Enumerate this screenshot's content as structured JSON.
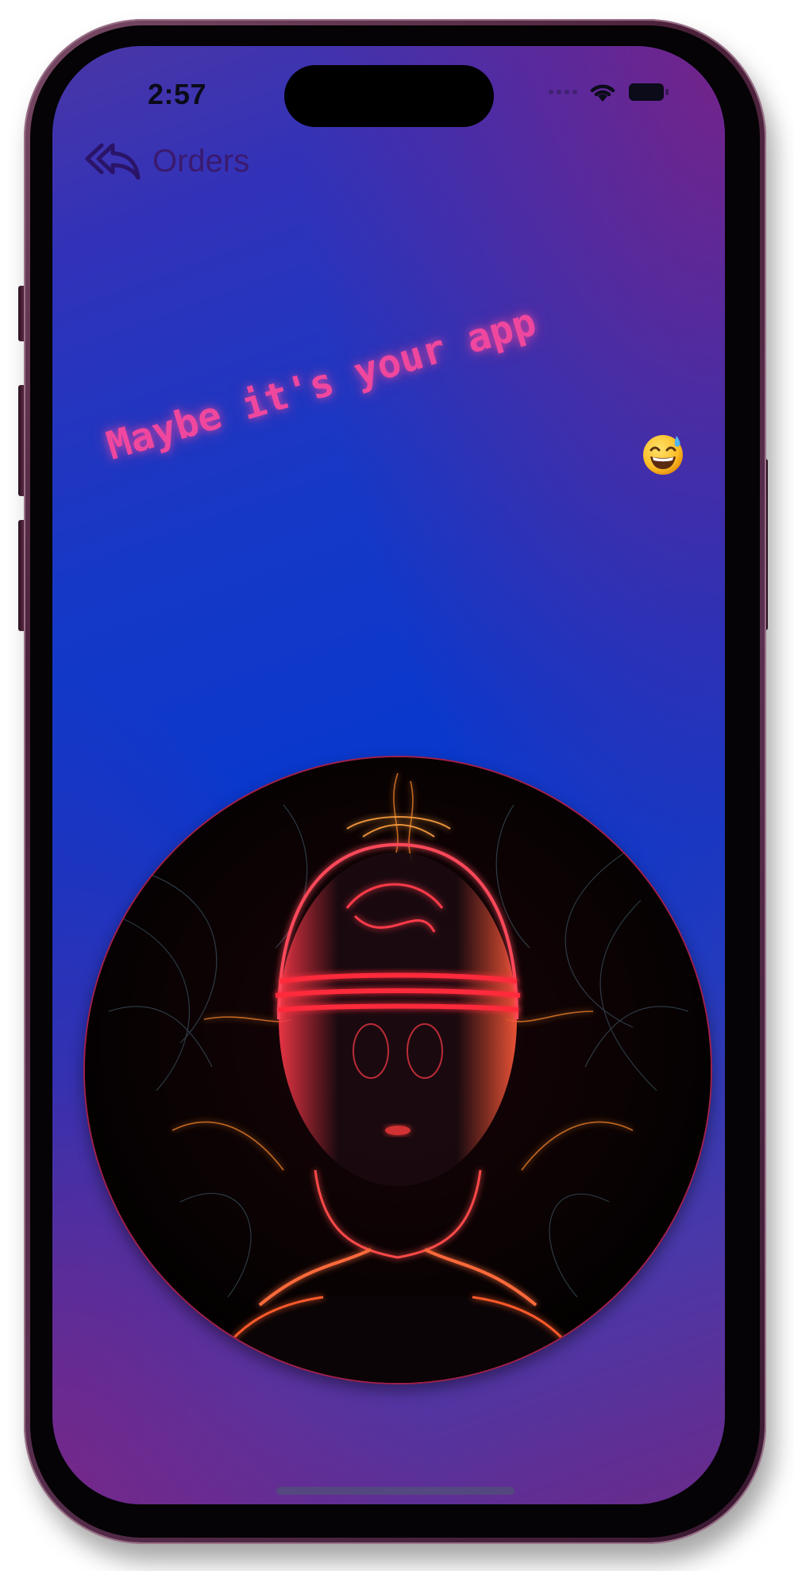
{
  "status_bar": {
    "time": "2:57",
    "icons": [
      "signal-dots-icon",
      "wifi-icon",
      "battery-icon"
    ]
  },
  "nav": {
    "back_label": "Orders",
    "back_icon": "double-reply-arrow-icon"
  },
  "banner": {
    "text": "Maybe it's your app",
    "emoji": "grinning-face-with-sweat-emoji",
    "color": "#f0479e"
  },
  "image": {
    "subject": "neon-light-head-portrait"
  },
  "colors": {
    "background_top": "#4a36a6",
    "background_mid": "#0a38cc",
    "background_corner": "#8c1e78",
    "nav_tint": "#3a1a6e"
  }
}
